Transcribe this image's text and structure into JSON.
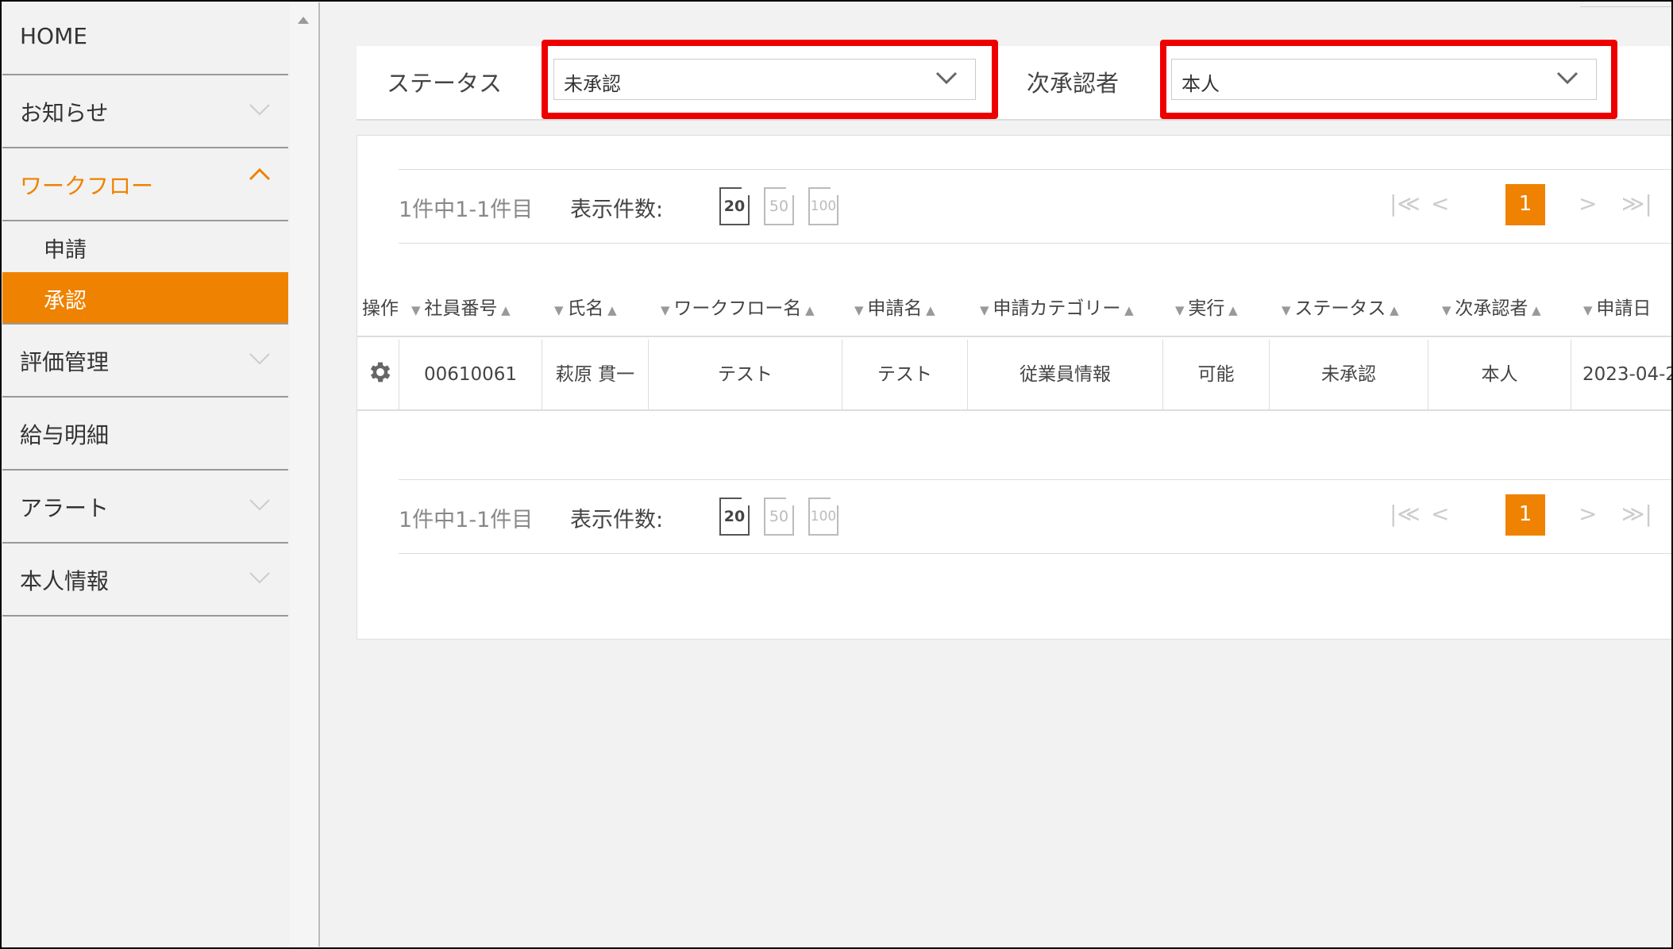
{
  "sidebar": {
    "items": [
      {
        "label": "HOME"
      },
      {
        "label": "お知らせ"
      },
      {
        "label": "ワークフロー"
      },
      {
        "label": "評価管理"
      },
      {
        "label": "給与明細"
      },
      {
        "label": "アラート"
      },
      {
        "label": "本人情報"
      }
    ],
    "workflow_sub": [
      {
        "label": "申請"
      },
      {
        "label": "承認"
      }
    ]
  },
  "filters": {
    "status_label": "ステータス",
    "status_value": "未承認",
    "approver_label": "次承認者",
    "approver_value": "本人"
  },
  "pager": {
    "count_text": "1件中1-1件目",
    "per_page_label": "表示件数:",
    "per_page_options": [
      "20",
      "50",
      "100"
    ],
    "current_page": "1",
    "first": "|≪",
    "prev": "<",
    "next": ">",
    "last": "≫|"
  },
  "table": {
    "headers": [
      "操作",
      "社員番号",
      "氏名",
      "ワークフロー名",
      "申請名",
      "申請カテゴリー",
      "実行",
      "ステータス",
      "次承認者",
      "申請日"
    ],
    "rows": [
      {
        "emp_no": "00610061",
        "name": "萩原 貫一",
        "workflow": "テスト",
        "app_name": "テスト",
        "category": "従業員情報",
        "exec": "可能",
        "status": "未承認",
        "next": "本人",
        "date": "2023-04-2"
      }
    ]
  },
  "colors": {
    "accent": "#ef8200",
    "highlight": "#ee0000"
  }
}
